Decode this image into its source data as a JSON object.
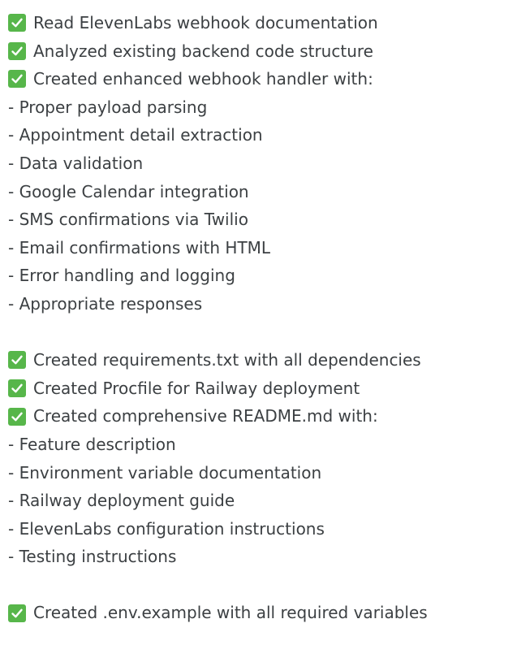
{
  "icons": {
    "check": "check-mark-icon",
    "check_color": "#57b64a"
  },
  "sections": [
    {
      "checks": [
        "Read ElevenLabs webhook documentation",
        "Analyzed existing backend code structure",
        "Created enhanced webhook handler with:"
      ],
      "items": [
        "- Proper payload parsing",
        "- Appointment detail extraction",
        "- Data validation",
        "- Google Calendar integration",
        "- SMS confirmations via Twilio",
        "- Email confirmations with HTML",
        "- Error handling and logging",
        "- Appropriate responses"
      ]
    },
    {
      "checks": [
        "Created requirements.txt with all dependencies",
        "Created Procfile for Railway deployment",
        "Created comprehensive README.md with:"
      ],
      "items": [
        "- Feature description",
        "- Environment variable documentation",
        "- Railway deployment guide",
        "- ElevenLabs configuration instructions",
        "- Testing instructions"
      ]
    },
    {
      "checks": [
        "Created .env.example with all required variables"
      ],
      "items": []
    }
  ]
}
